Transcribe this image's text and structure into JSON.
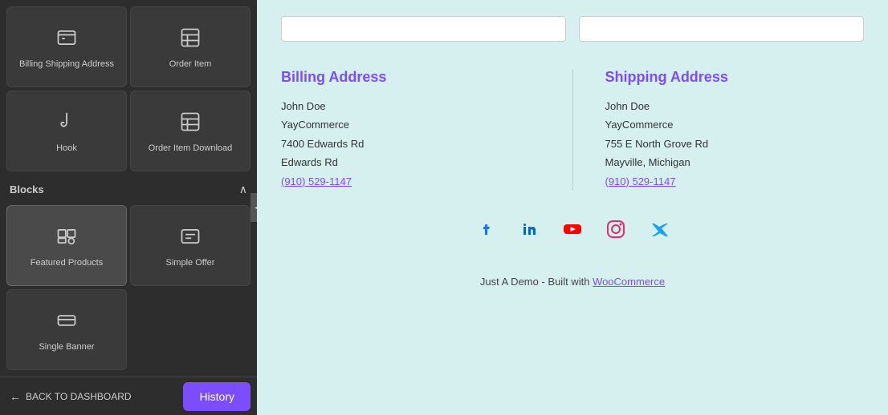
{
  "sidebar": {
    "blocks_header": "Blocks",
    "collapse_icon": "∧",
    "blocks": [
      {
        "id": "billing-shipping",
        "label": "Billing Shipping Address",
        "icon": "billing"
      },
      {
        "id": "order-item",
        "label": "Order Item",
        "icon": "order-item"
      },
      {
        "id": "hook",
        "label": "Hook",
        "icon": "hook"
      },
      {
        "id": "order-item-download",
        "label": "Order Item Download",
        "icon": "order-item-download"
      },
      {
        "id": "featured-products",
        "label": "Featured Products",
        "icon": "featured",
        "active": true
      },
      {
        "id": "simple-offer",
        "label": "Simple Offer",
        "icon": "simple-offer"
      },
      {
        "id": "single-banner",
        "label": "Single Banner",
        "icon": "single-banner"
      }
    ],
    "back_label": "BACK TO DASHBOARD",
    "history_label": "History"
  },
  "main": {
    "billing_address": {
      "title": "Billing Address",
      "name": "John Doe",
      "company": "YayCommerce",
      "address1": "7400 Edwards Rd",
      "address2": "Edwards Rd",
      "phone": "(910) 529-1147"
    },
    "shipping_address": {
      "title": "Shipping Address",
      "name": "John Doe",
      "company": "YayCommerce",
      "address1": "755 E North Grove Rd",
      "address2": "Mayville, Michigan",
      "phone": "(910) 529-1147"
    },
    "social_icons": [
      {
        "id": "facebook",
        "label": "f",
        "class": "social-fb"
      },
      {
        "id": "linkedin",
        "label": "in",
        "class": "social-li"
      },
      {
        "id": "youtube",
        "label": "▶",
        "class": "social-yt"
      },
      {
        "id": "instagram",
        "label": "◎",
        "class": "social-ig"
      },
      {
        "id": "twitter",
        "label": "𝕏",
        "class": "social-tw"
      }
    ],
    "footer_text": "Just A Demo - Built with ",
    "footer_link": "WooCommerce"
  }
}
